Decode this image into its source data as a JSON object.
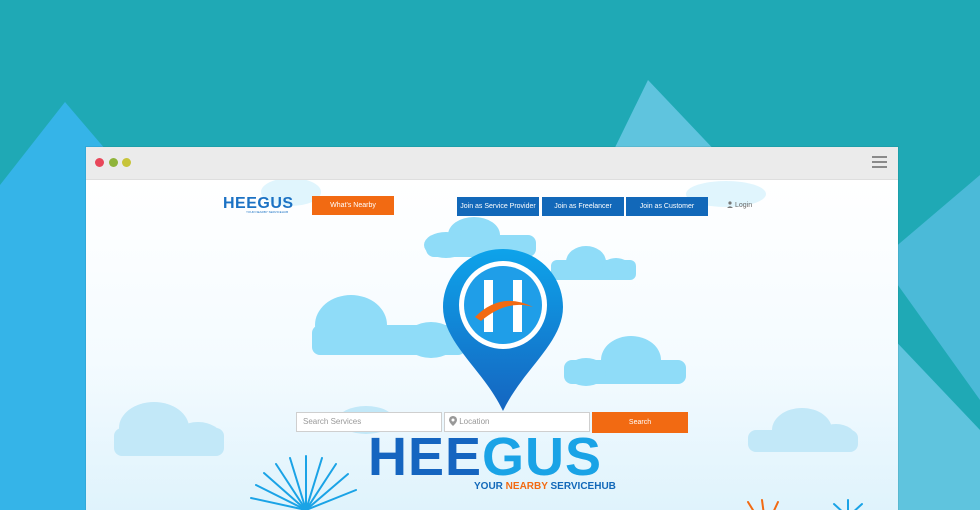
{
  "header": {
    "logo_text": "HEEGUS",
    "logo_tagline": "YOUR NEARBY SERVICEHUB",
    "whats_nearby": "What's Nearby",
    "join_provider": "Join as Service Provider",
    "join_freelancer": "Join as Freelancer",
    "join_customer": "Join as Customer",
    "login": "Login"
  },
  "search": {
    "services_placeholder": "Search Services",
    "location_placeholder": "Location",
    "button": "Search"
  },
  "hero": {
    "brand_part1": "HEE",
    "brand_part2": "GUS",
    "tagline_part1": "YOUR ",
    "tagline_part2": "NEARBY",
    "tagline_part3": " SERVICEHUB"
  },
  "colors": {
    "background": "#1fa9b5",
    "orange": "#f26a12",
    "blue": "#1268b9",
    "sky": "#8fdcf8"
  },
  "icons": [
    "close-dot",
    "minimize-dot",
    "maximize-dot",
    "hamburger-menu-icon",
    "user-icon",
    "location-pin-icon",
    "map-pin-logo-icon"
  ]
}
